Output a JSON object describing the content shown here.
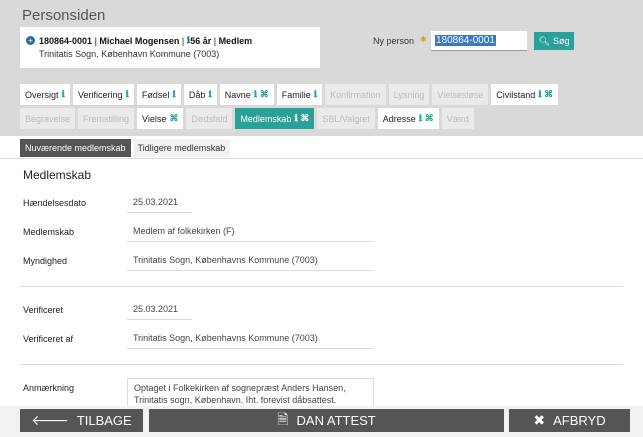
{
  "page_title": "Personsiden",
  "person": {
    "id": "180864-0001",
    "name": "Michael Mogensen",
    "age": "56 år",
    "status": "Medlem",
    "address": "Trinitatis Sogn, København Kommune (7003)"
  },
  "search": {
    "label": "Ny person",
    "value": "180864-0001",
    "button_label": "Søg"
  },
  "tabs_row1": [
    {
      "label": "Oversigt",
      "icons": "ℹ",
      "state": "normal"
    },
    {
      "label": "Verificering",
      "icons": "ℹ",
      "state": "normal"
    },
    {
      "label": "Fødsel",
      "icons": "ℹ",
      "state": "normal"
    },
    {
      "label": "Dåb",
      "icons": "ℹ",
      "state": "normal"
    },
    {
      "label": "Navne",
      "icons": "ℹ ⌘",
      "state": "normal"
    },
    {
      "label": "Familie",
      "icons": "ℹ",
      "state": "normal"
    },
    {
      "label": "Konfirmation",
      "icons": "",
      "state": "disabled"
    },
    {
      "label": "Lysning",
      "icons": "",
      "state": "disabled"
    },
    {
      "label": "Vielsesløse",
      "icons": "",
      "state": "disabled"
    },
    {
      "label": "Civilstand",
      "icons": "ℹ ⌘",
      "state": "normal"
    }
  ],
  "tabs_row2": [
    {
      "label": "Begravelse",
      "icons": "",
      "state": "disabled"
    },
    {
      "label": "Fremstilling",
      "icons": "",
      "state": "disabled"
    },
    {
      "label": "Vielse",
      "icons": "⌘",
      "state": "normal"
    },
    {
      "label": "Dødsfald",
      "icons": "",
      "state": "disabled"
    },
    {
      "label": "Medlemskab",
      "icons": "ℹ ⌘",
      "state": "active"
    },
    {
      "label": "SBL/Valgret",
      "icons": "",
      "state": "disabled"
    },
    {
      "label": "Adresse",
      "icons": "ℹ ⌘",
      "state": "normal"
    },
    {
      "label": "Værd",
      "icons": "",
      "state": "disabled"
    }
  ],
  "membership_tabs": {
    "current": "Nuværende medlemskab",
    "previous": "Tidligere medlemskab"
  },
  "section_title": "Medlemskab",
  "fields": {
    "event_date_label": "Hændelsesdato",
    "event_date_value": "25.03.2021",
    "membership_label": "Medlemskab",
    "membership_value": "Medlem af folkekirken (F)",
    "authority_label": "Myndighed",
    "authority_value": "Trinitatis Sogn, Københavns Kommune (7003)",
    "verified_label": "Verificeret",
    "verified_value": "25.03.2021",
    "verified_by_label": "Verificeret af",
    "verified_by_value": "Trinitatis Sogn, Københavns Kommune (7003)",
    "note_label": "Anmærkning",
    "note_value": "Optaget i Folkekirken af sognepræst Anders Hansen, Trinitatis sogn, København. Iht. forevist dåbsattest."
  },
  "footer": {
    "back_label": "TILBAGE",
    "certificate_label": "DAN ATTEST",
    "cancel_label": "AFBRYD"
  },
  "colors": {
    "accent": "#2aa198",
    "header_bg": "#d9d9d9",
    "footer_button": "#555555"
  }
}
